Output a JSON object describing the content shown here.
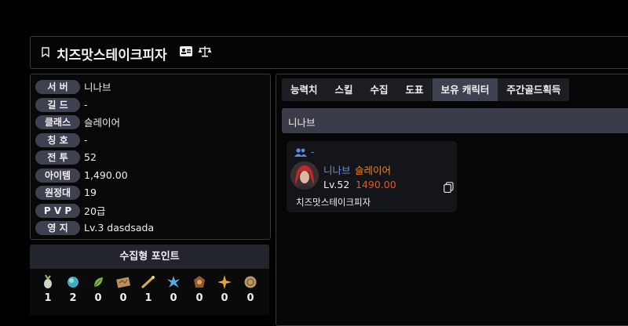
{
  "header": {
    "title": "치즈맛스테이크피자"
  },
  "profile": [
    {
      "label": "서 버",
      "value": "니나브"
    },
    {
      "label": "길 드",
      "value": "-"
    },
    {
      "label": "클래스",
      "value": "슬레이어"
    },
    {
      "label": "칭 호",
      "value": "-"
    },
    {
      "label": "전 투",
      "value": "52"
    },
    {
      "label": "아이템",
      "value": "1,490.00"
    },
    {
      "label": "원정대",
      "value": "19"
    },
    {
      "label": "P V P",
      "value": "20급"
    },
    {
      "label": "영 지",
      "value": "Lv.3 dasdsada"
    }
  ],
  "collection": {
    "title": "수집형 포인트",
    "items": [
      {
        "icon": "mokoko-seed-icon",
        "count": "1"
      },
      {
        "icon": "island-heart-icon",
        "count": "2"
      },
      {
        "icon": "world-tree-leaf-icon",
        "count": "0"
      },
      {
        "icon": "art-map-icon",
        "count": "0"
      },
      {
        "icon": "voyage-pipe-icon",
        "count": "1"
      },
      {
        "icon": "giant-heart-icon",
        "count": "0"
      },
      {
        "icon": "ignea-token-icon",
        "count": "0"
      },
      {
        "icon": "orpheus-star-icon",
        "count": "0"
      },
      {
        "icon": "sea-bounty-icon",
        "count": "0"
      }
    ]
  },
  "tabs": [
    "능력치",
    "스킬",
    "수집",
    "도표",
    "보유 캐릭터",
    "주간골드획득"
  ],
  "active_tab": "보유 캐릭터",
  "server_bar": "니나브",
  "character_card": {
    "group": "-",
    "name": "니나브",
    "class": "슬레이어",
    "level": "Lv.52",
    "item_level": "1490.00",
    "character_name": "치즈맛스테이크피자"
  },
  "colors": {
    "accent_blue": "#6b8fe6",
    "class_orange": "#e8892a",
    "item_level_red": "#e0562e",
    "pill_bg": "#3d4150"
  }
}
